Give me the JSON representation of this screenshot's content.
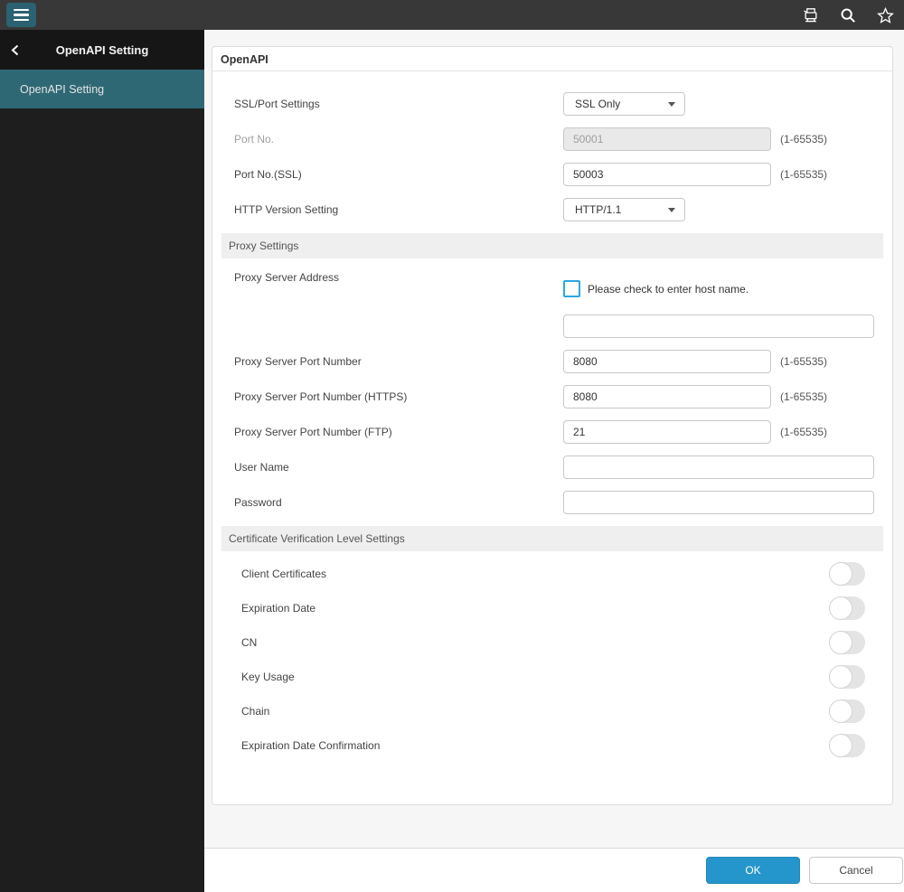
{
  "topbar": {
    "icons": [
      {
        "name": "device-printer-icon"
      },
      {
        "name": "search-icon"
      },
      {
        "name": "favorite-star-icon"
      }
    ]
  },
  "sidebar": {
    "back_icon": "chevron-left",
    "title": "OpenAPI Setting",
    "items": [
      {
        "label": "OpenAPI Setting",
        "selected": true
      }
    ]
  },
  "main": {
    "title": "OpenAPI",
    "ssl_port_settings": {
      "label": "SSL/Port Settings",
      "value": "SSL Only"
    },
    "port_no": {
      "label": "Port No.",
      "value": "50001",
      "hint": "(1-65535)",
      "disabled": true
    },
    "port_no_ssl": {
      "label": "Port No.(SSL)",
      "value": "50003",
      "hint": "(1-65535)"
    },
    "http_version": {
      "label": "HTTP Version Setting",
      "value": "HTTP/1.1"
    },
    "proxy": {
      "section_title": "Proxy Settings",
      "server_address": {
        "label": "Proxy Server Address",
        "checkbox_label": "Please check to enter host name.",
        "checked": false,
        "value": ""
      },
      "port": {
        "label": "Proxy Server Port Number",
        "value": "8080",
        "hint": "(1-65535)"
      },
      "port_https": {
        "label": "Proxy Server Port Number (HTTPS)",
        "value": "8080",
        "hint": "(1-65535)"
      },
      "port_ftp": {
        "label": "Proxy Server Port Number (FTP)",
        "value": "21",
        "hint": "(1-65535)"
      },
      "user_name": {
        "label": "User Name",
        "value": ""
      },
      "password": {
        "label": "Password",
        "value": ""
      }
    },
    "certificate": {
      "section_title": "Certificate Verification Level Settings",
      "toggles": [
        {
          "label": "Client Certificates",
          "state": "off"
        },
        {
          "label": "Expiration Date",
          "state": "off"
        },
        {
          "label": "CN",
          "state": "off"
        },
        {
          "label": "Key Usage",
          "state": "off"
        },
        {
          "label": "Chain",
          "state": "off"
        },
        {
          "label": "Expiration Date Confirmation",
          "state": "off"
        }
      ]
    }
  },
  "footer": {
    "ok": "OK",
    "cancel": "Cancel"
  },
  "colors": {
    "topbar_bg": "#383838",
    "menu_button_bg": "#2b6170",
    "sidebar_bg": "#1e1e1e",
    "sidebar_selected_bg": "#2e6875",
    "primary_button_bg": "#2596cb",
    "checkbox_border": "#2ba7e0"
  }
}
